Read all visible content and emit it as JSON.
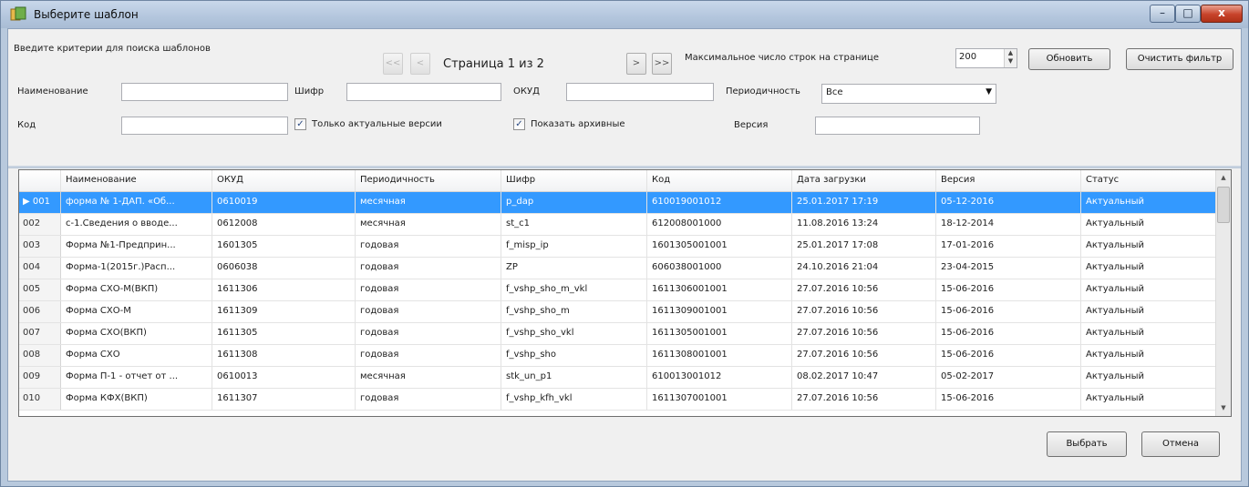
{
  "window": {
    "title": "Выберите шаблон",
    "controls": {
      "minimize": "–",
      "maximize": "□",
      "close": "x"
    }
  },
  "toolbar": {
    "criteria_label": "Введите критерии для поиска шаблонов",
    "first_page": "<<",
    "prev_page": "<",
    "page_info": "Страница 1 из 2",
    "next_page": ">",
    "last_page": ">>",
    "max_rows_label": "Максимальное число строк на странице",
    "max_rows_value": "200",
    "refresh_button": "Обновить",
    "clear_filter_button": "Очистить фильтр"
  },
  "filters": {
    "name_label": "Наименование",
    "name_value": "",
    "cipher_label": "Шифр",
    "cipher_value": "",
    "okud_label": "ОКУД",
    "okud_value": "",
    "periodicity_label": "Периодичность",
    "periodicity_value": "Все",
    "code_label": "Код",
    "code_value": "",
    "actual_only_label": "Только актуальные версии",
    "actual_only_checked": true,
    "show_archive_label": "Показать архивные",
    "show_archive_checked": true,
    "version_label": "Версия",
    "version_value": ""
  },
  "grid": {
    "columns": [
      "Наименование",
      "ОКУД",
      "Периодичность",
      "Шифр",
      "Код",
      "Дата загрузки",
      "Версия",
      "Статус"
    ],
    "rows": [
      {
        "num": "001",
        "name": "форма № 1-ДАП. «Об...",
        "okud": "0610019",
        "period": "месячная",
        "cipher": "p_dap",
        "code": "610019001012",
        "date": "25.01.2017 17:19",
        "version": "05-12-2016",
        "status": "Актуальный"
      },
      {
        "num": "002",
        "name": "с-1.Сведения о вводе...",
        "okud": "0612008",
        "period": "месячная",
        "cipher": "st_c1",
        "code": "612008001000",
        "date": "11.08.2016 13:24",
        "version": "18-12-2014",
        "status": "Актуальный"
      },
      {
        "num": "003",
        "name": "Форма №1-Предприн...",
        "okud": "1601305",
        "period": "годовая",
        "cipher": "f_misp_ip",
        "code": "1601305001001",
        "date": "25.01.2017 17:08",
        "version": "17-01-2016",
        "status": "Актуальный"
      },
      {
        "num": "004",
        "name": "Форма-1(2015г.)Расп...",
        "okud": "0606038",
        "period": "годовая",
        "cipher": "ZP",
        "code": "606038001000",
        "date": "24.10.2016 21:04",
        "version": "23-04-2015",
        "status": "Актуальный"
      },
      {
        "num": "005",
        "name": "Форма СХО-М(ВКП)",
        "okud": "1611306",
        "period": "годовая",
        "cipher": "f_vshp_sho_m_vkl",
        "code": "1611306001001",
        "date": "27.07.2016 10:56",
        "version": "15-06-2016",
        "status": "Актуальный"
      },
      {
        "num": "006",
        "name": "Форма СХО-М",
        "okud": "1611309",
        "period": "годовая",
        "cipher": "f_vshp_sho_m",
        "code": "1611309001001",
        "date": "27.07.2016 10:56",
        "version": "15-06-2016",
        "status": "Актуальный"
      },
      {
        "num": "007",
        "name": "Форма СХО(ВКП)",
        "okud": "1611305",
        "period": "годовая",
        "cipher": "f_vshp_sho_vkl",
        "code": "1611305001001",
        "date": "27.07.2016 10:56",
        "version": "15-06-2016",
        "status": "Актуальный"
      },
      {
        "num": "008",
        "name": "Форма СХО",
        "okud": "1611308",
        "period": "годовая",
        "cipher": "f_vshp_sho",
        "code": "1611308001001",
        "date": "27.07.2016 10:56",
        "version": "15-06-2016",
        "status": "Актуальный"
      },
      {
        "num": "009",
        "name": "Форма П-1 - отчет от ...",
        "okud": "0610013",
        "period": "месячная",
        "cipher": "stk_un_p1",
        "code": "610013001012",
        "date": "08.02.2017 10:47",
        "version": "05-02-2017",
        "status": "Актуальный"
      },
      {
        "num": "010",
        "name": "Форма КФХ(ВКП)",
        "okud": "1611307",
        "period": "годовая",
        "cipher": "f_vshp_kfh_vkl",
        "code": "1611307001001",
        "date": "27.07.2016 10:56",
        "version": "15-06-2016",
        "status": "Актуальный"
      }
    ]
  },
  "footer": {
    "select_button": "Выбрать",
    "cancel_button": "Отмена"
  }
}
